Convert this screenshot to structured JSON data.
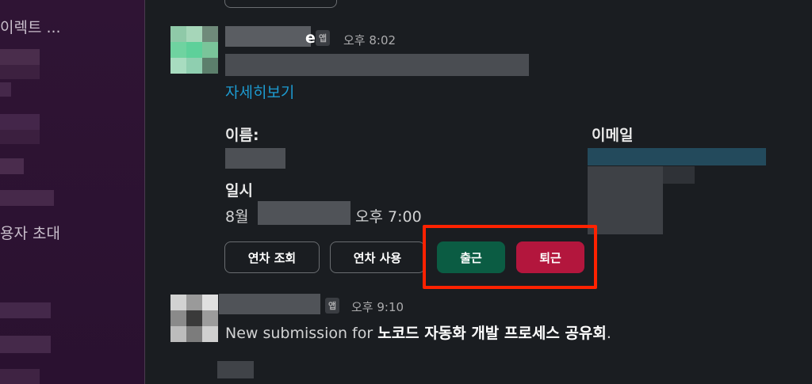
{
  "sidebar": {
    "item_direct": "이렉트 ...",
    "item_invite": "용자 초대"
  },
  "message1": {
    "name_suffix": "e",
    "app_badge": "앱",
    "time": "오후 8:02",
    "details_link": "자세히보기",
    "name_label": "이름:",
    "email_label": "이메일",
    "datetime_label": "일시",
    "date_prefix": "8월",
    "date_time": "오후 7:00",
    "buttons": {
      "leave_lookup": "연차 조회",
      "leave_use": "연차 사용",
      "clock_in": "출근",
      "clock_out": "퇴근"
    }
  },
  "message2": {
    "app_badge": "앱",
    "time": "오후 9:10",
    "text_prefix": "New submission for ",
    "text_bold": "노코드 자동화 개발 프로세스 공유회",
    "text_suffix": "."
  },
  "colors": {
    "highlight_border": "#ff2200",
    "clock_in_bg": "#0b5c43",
    "clock_out_bg": "#b3163d",
    "link": "#1d9bd1"
  }
}
